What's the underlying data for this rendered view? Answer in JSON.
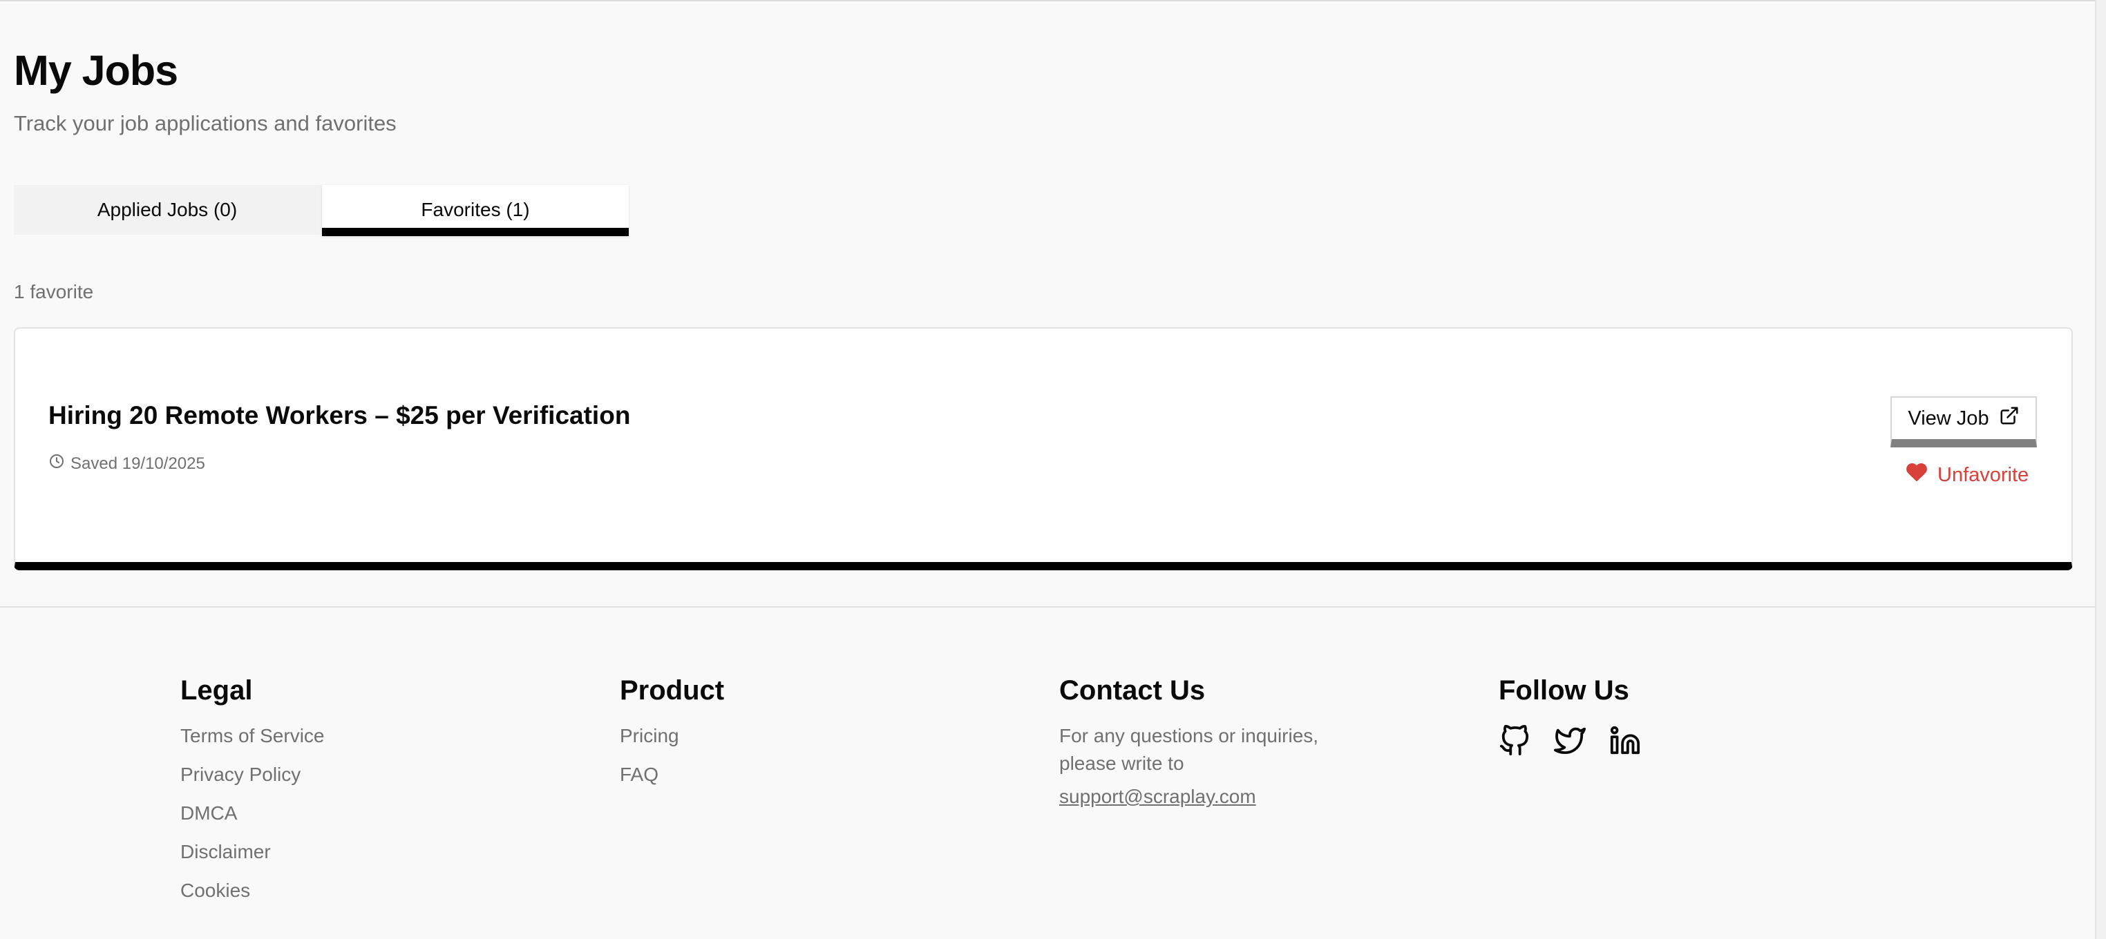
{
  "header": {
    "title": "My Jobs",
    "subtitle": "Track your job applications and favorites"
  },
  "tabs": [
    {
      "label": "Applied Jobs (0)",
      "active": false
    },
    {
      "label": "Favorites (1)",
      "active": true
    }
  ],
  "favorites": {
    "count_text": "1 favorite",
    "items": [
      {
        "title": "Hiring 20 Remote Workers – $25 per Verification",
        "saved_text": "Saved 19/10/2025",
        "view_label": "View Job",
        "unfavorite_label": "Unfavorite"
      }
    ]
  },
  "footer": {
    "legal": {
      "heading": "Legal",
      "links": [
        "Terms of Service",
        "Privacy Policy",
        "DMCA",
        "Disclaimer",
        "Cookies"
      ]
    },
    "product": {
      "heading": "Product",
      "links": [
        "Pricing",
        "FAQ"
      ]
    },
    "contact": {
      "heading": "Contact Us",
      "line1": "For any questions or inquiries,",
      "line2_prefix": "please write to ",
      "email": "support@scraplay.com"
    },
    "follow": {
      "heading": "Follow Us",
      "icons": [
        "github-icon",
        "twitter-icon",
        "linkedin-icon"
      ]
    }
  },
  "colors": {
    "background": "#f9f9f9",
    "accent": "#000000",
    "danger": "#d8403a",
    "muted": "#707070"
  }
}
